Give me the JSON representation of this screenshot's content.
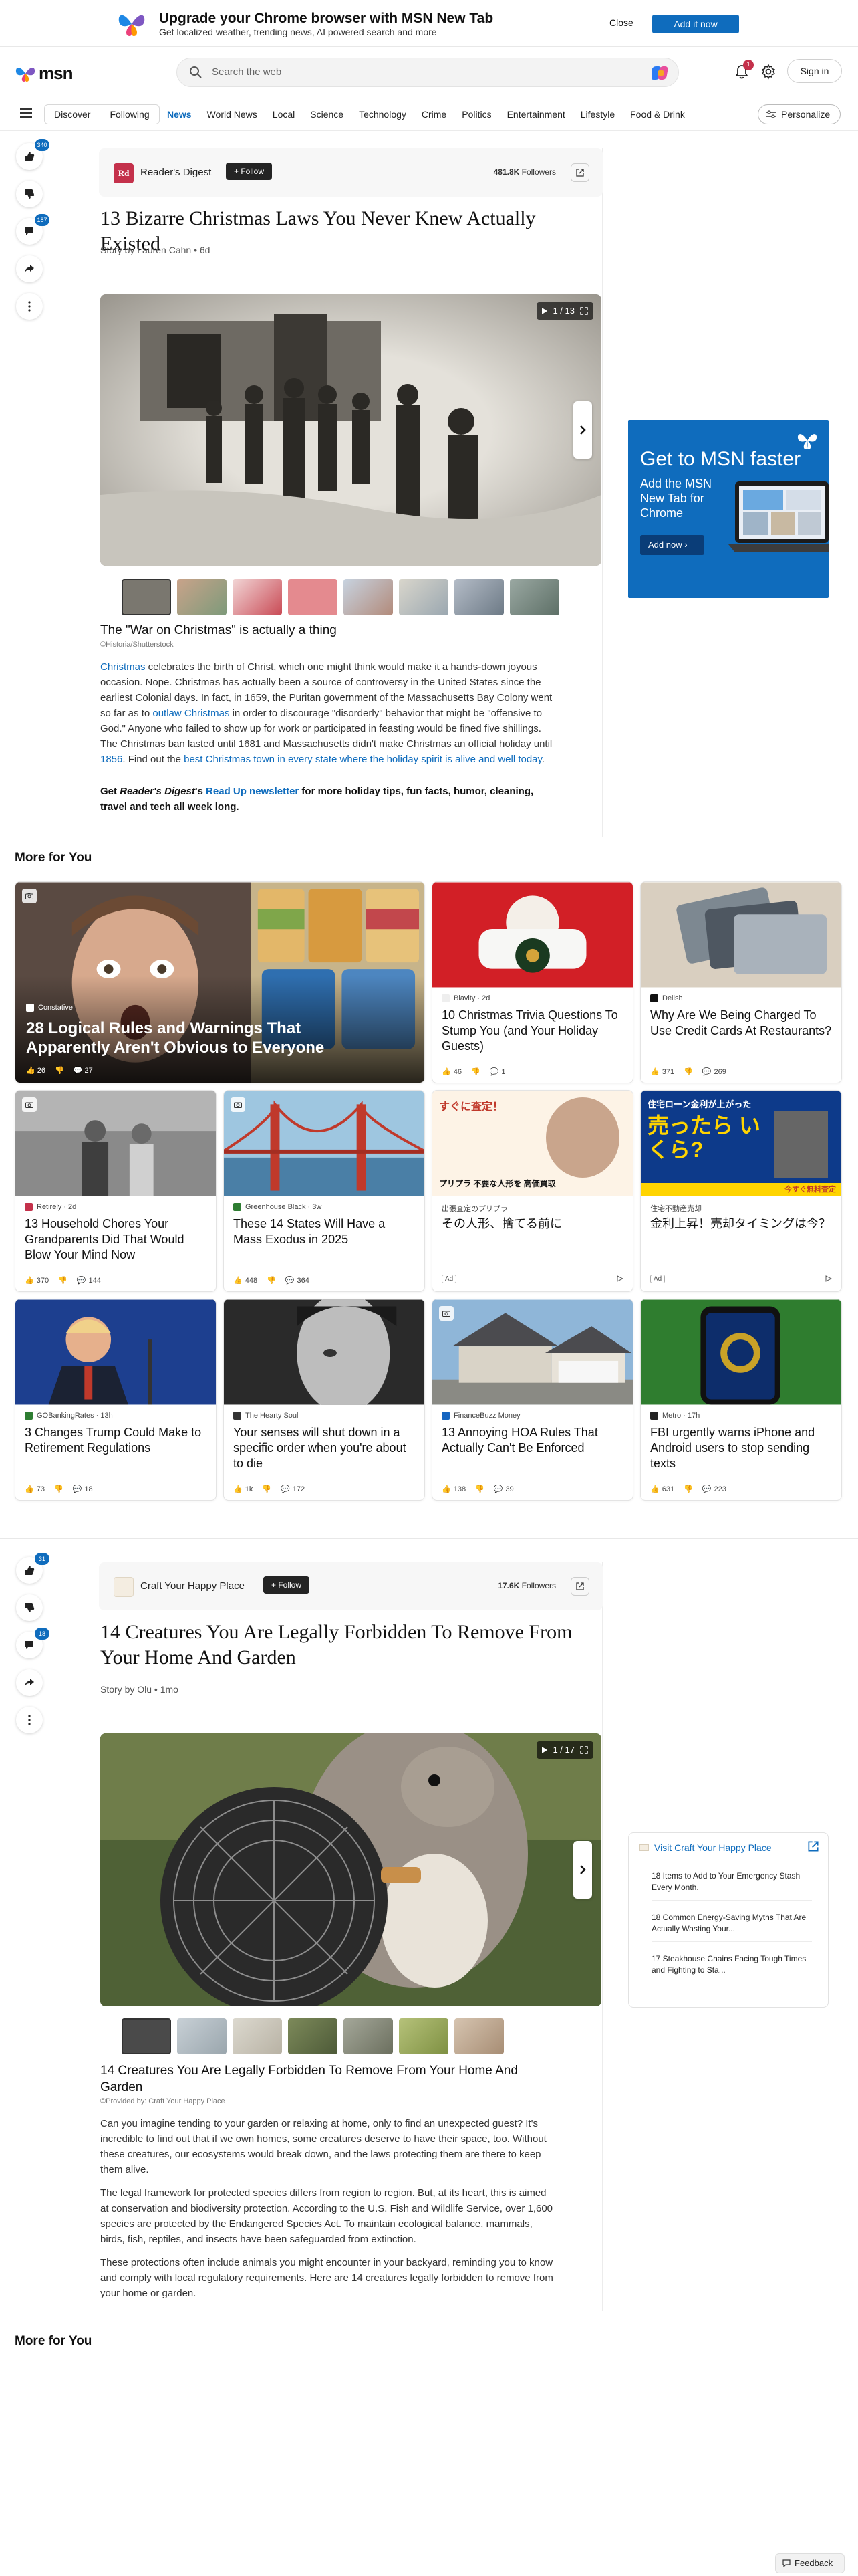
{
  "promo": {
    "title": "Upgrade your Chrome browser with MSN New Tab",
    "subtitle": "Get localized weather, trending news, AI powered search and more",
    "close_label": "Close",
    "add_label": "Add it now"
  },
  "header": {
    "logo_text": "msn",
    "search_placeholder": "Search the web",
    "notification_count": "1",
    "signin_label": "Sign in"
  },
  "nav": {
    "discover": "Discover",
    "following": "Following",
    "items": [
      "News",
      "World News",
      "Local",
      "Science",
      "Technology",
      "Crime",
      "Politics",
      "Entertainment",
      "Lifestyle",
      "Food & Drink"
    ],
    "active": "News",
    "personalize": "Personalize"
  },
  "rail1": {
    "like_count": "340",
    "comment_count": "187"
  },
  "rail2": {
    "like_count": "31",
    "comment_count": "18"
  },
  "article1": {
    "publisher": "Reader's Digest",
    "publisher_logo": "Rd",
    "follow_label": "+ Follow",
    "followers_count": "481.8K",
    "followers_label": "Followers",
    "title": "13 Bizarre Christmas Laws You Never Knew Actually Existed",
    "byline": "Story by Lauren Cahn • 6d",
    "slide_counter": "1 / 13",
    "slide_title": "The \"War on Christmas\" is actually a thing",
    "credit": "©Historia/Shutterstock",
    "para1": {
      "link1": "Christmas",
      "text1": " celebrates the birth of Christ, which one might think would make it a hands-down joyous occasion. Nope. Christmas has actually been a source of controversy in the United States since the earliest Colonial days. In fact, in 1659, the Puritan government of the Massachusetts Bay Colony went so far as to ",
      "link2": "outlaw Christmas",
      "text2": " in order to discourage \"disorderly\" behavior that might be \"offensive to God.\" Anyone who failed to show up for work or participated in feasting would be fined five shillings. The Christmas ban lasted until 1681 and Massachusetts didn't make Christmas an official holiday until ",
      "link3": "1856",
      "text3": ". Find out the ",
      "link4": "best Christmas town in every state where the holiday spirit is alive and well today",
      "text4": "."
    },
    "para2": {
      "pre": "Get ",
      "em": "Reader's Digest",
      "mid": "'s ",
      "link": "Read Up newsletter",
      "post": " for more holiday tips, fun facts, humor, cleaning, travel and tech all week long."
    }
  },
  "ad": {
    "headline": "Get to MSN faster",
    "sub": "Add the MSN New Tab for Chrome",
    "button": "Add now"
  },
  "more_for_you": "More for You",
  "cards": [
    {
      "source": "Constative",
      "title": "28 Logical Rules and Warnings That Apparently Aren't Obvious to Everyone",
      "likes": "26",
      "comments": "27"
    },
    {
      "source": "Blavity · 2d",
      "title": "10 Christmas Trivia Questions To Stump You (and Your Holiday Guests)",
      "likes": "46",
      "comments": "1"
    },
    {
      "source": "Delish",
      "title": "Why Are We Being Charged To Use Credit Cards At Restaurants?",
      "likes": "371",
      "comments": "269"
    },
    {
      "source": "Retirely · 2d",
      "title": "13 Household Chores Your Grandparents Did That Would Blow Your Mind Now",
      "likes": "370",
      "comments": "144"
    },
    {
      "source": "Greenhouse Black · 3w",
      "title": "These 14 States Will Have a Mass Exodus in 2025",
      "likes": "448",
      "comments": "364"
    },
    {
      "source": "出張査定のプリプラ",
      "title": "その人形、捨てる前に",
      "ad": "Ad",
      "img_text1": "すぐに査定！",
      "img_text2": "プリプラ 不要な人形を 高価買取"
    },
    {
      "source": "住宅不動産売却",
      "title": "金利上昇！売却タイミングは今？",
      "ad": "Ad",
      "img_text1": "住宅ローン金利が上がった",
      "img_text2": "売ったら いくら?",
      "img_text3": "今すぐ無料査定"
    },
    {
      "source": "GOBankingRates · 13h",
      "title": "3 Changes Trump Could Make to Retirement Regulations",
      "likes": "73",
      "comments": "18"
    },
    {
      "source": "The Hearty Soul",
      "title": "Your senses will shut down in a specific order when you're about to die",
      "likes": "1k",
      "comments": "172"
    },
    {
      "source": "FinanceBuzz Money",
      "title": "13 Annoying HOA Rules That Actually Can't Be Enforced",
      "likes": "138",
      "comments": "39"
    },
    {
      "source": "Metro · 17h",
      "title": "FBI urgently warns iPhone and Android users to stop sending texts",
      "likes": "631",
      "comments": "223"
    }
  ],
  "article2": {
    "publisher": "Craft Your Happy Place",
    "follow_label": "+ Follow",
    "followers_count": "17.6K",
    "followers_label": "Followers",
    "title": "14 Creatures You Are Legally Forbidden To Remove From Your Home And Garden",
    "byline": "Story by Olu • 1mo",
    "slide_counter": "1 / 17",
    "slide_title": "14 Creatures You Are Legally Forbidden To Remove From Your Home And Garden",
    "credit": "©Provided by: Craft Your Happy Place",
    "paragraphs": [
      "Can you imagine tending to your garden or relaxing at home, only to find an unexpected guest? It's incredible to find out that if we own homes, some creatures deserve to have their space, too. Without these creatures, our ecosystems would break down, and the laws protecting them are there to keep them alive.",
      "The legal framework for protected species differs from region to region. But, at its heart, this is aimed at conservation and biodiversity protection. According to the U.S. Fish and Wildlife Service, over 1,600 species are protected by the Endangered Species Act. To maintain ecological balance, mammals, birds, fish, reptiles, and insects have been safeguarded from extinction.",
      "These protections often include animals you might encounter in your backyard, reminding you to know and comply with local regulatory requirements. Here are 14 creatures legally forbidden to remove from your home or garden."
    ]
  },
  "visit_box": {
    "title": "Visit Craft Your Happy Place",
    "links": [
      "18 Items to Add to Your Emergency Stash Every Month.",
      "18 Common Energy-Saving Myths That Are Actually Wasting Your...",
      "17 Steakhouse Chains Facing Tough Times and Fighting to Sta..."
    ]
  },
  "feedback": "Feedback",
  "colors": {
    "accent": "#0f6cbd",
    "brand_red": "#c4314b"
  },
  "icons": [
    "copilot-icon",
    "bell-icon",
    "gear-icon",
    "thumb-up-icon",
    "thumb-down-icon",
    "comment-icon",
    "share-icon",
    "more-icon",
    "external-link-icon",
    "camera-icon",
    "butterfly-icon"
  ]
}
